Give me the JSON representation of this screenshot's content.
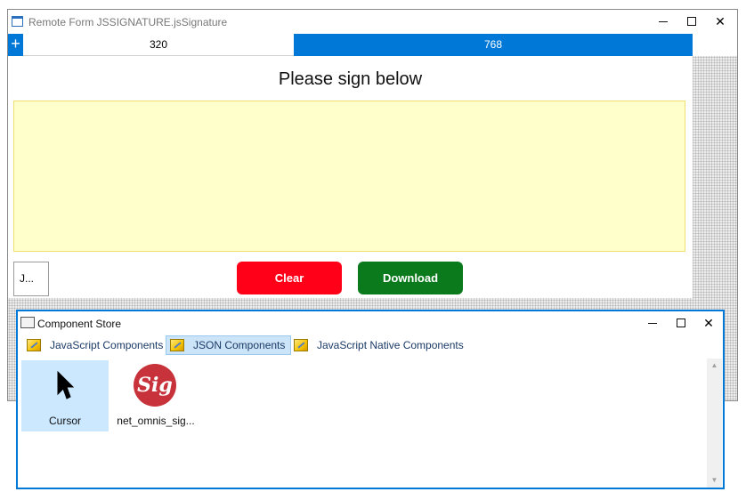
{
  "remote_form": {
    "title": "Remote Form JSSIGNATURE.jsSignature",
    "breakpoints": {
      "add_label": "+",
      "items": [
        "320",
        "768"
      ],
      "selected": "768"
    },
    "heading": "Please sign below",
    "small_control_text": "J...",
    "clear_label": "Clear",
    "download_label": "Download",
    "colors": {
      "signature_pad": "#ffffcc",
      "clear_button": "#ff0018",
      "download_button": "#0b7a1c",
      "accent": "#0078d7"
    }
  },
  "component_store": {
    "title": "Component Store",
    "tabs": [
      {
        "label": "JavaScript Components",
        "icon": "components-icon"
      },
      {
        "label": "JSON Components",
        "icon": "components-icon",
        "selected": true
      },
      {
        "label": "JavaScript Native Components",
        "icon": "components-icon"
      }
    ],
    "components": [
      {
        "label": "Cursor",
        "icon": "cursor-arrow-icon",
        "selected": true
      },
      {
        "label": "net_omnis_sig...",
        "icon": "signature-logo-icon",
        "icon_text": "Sig"
      }
    ]
  }
}
